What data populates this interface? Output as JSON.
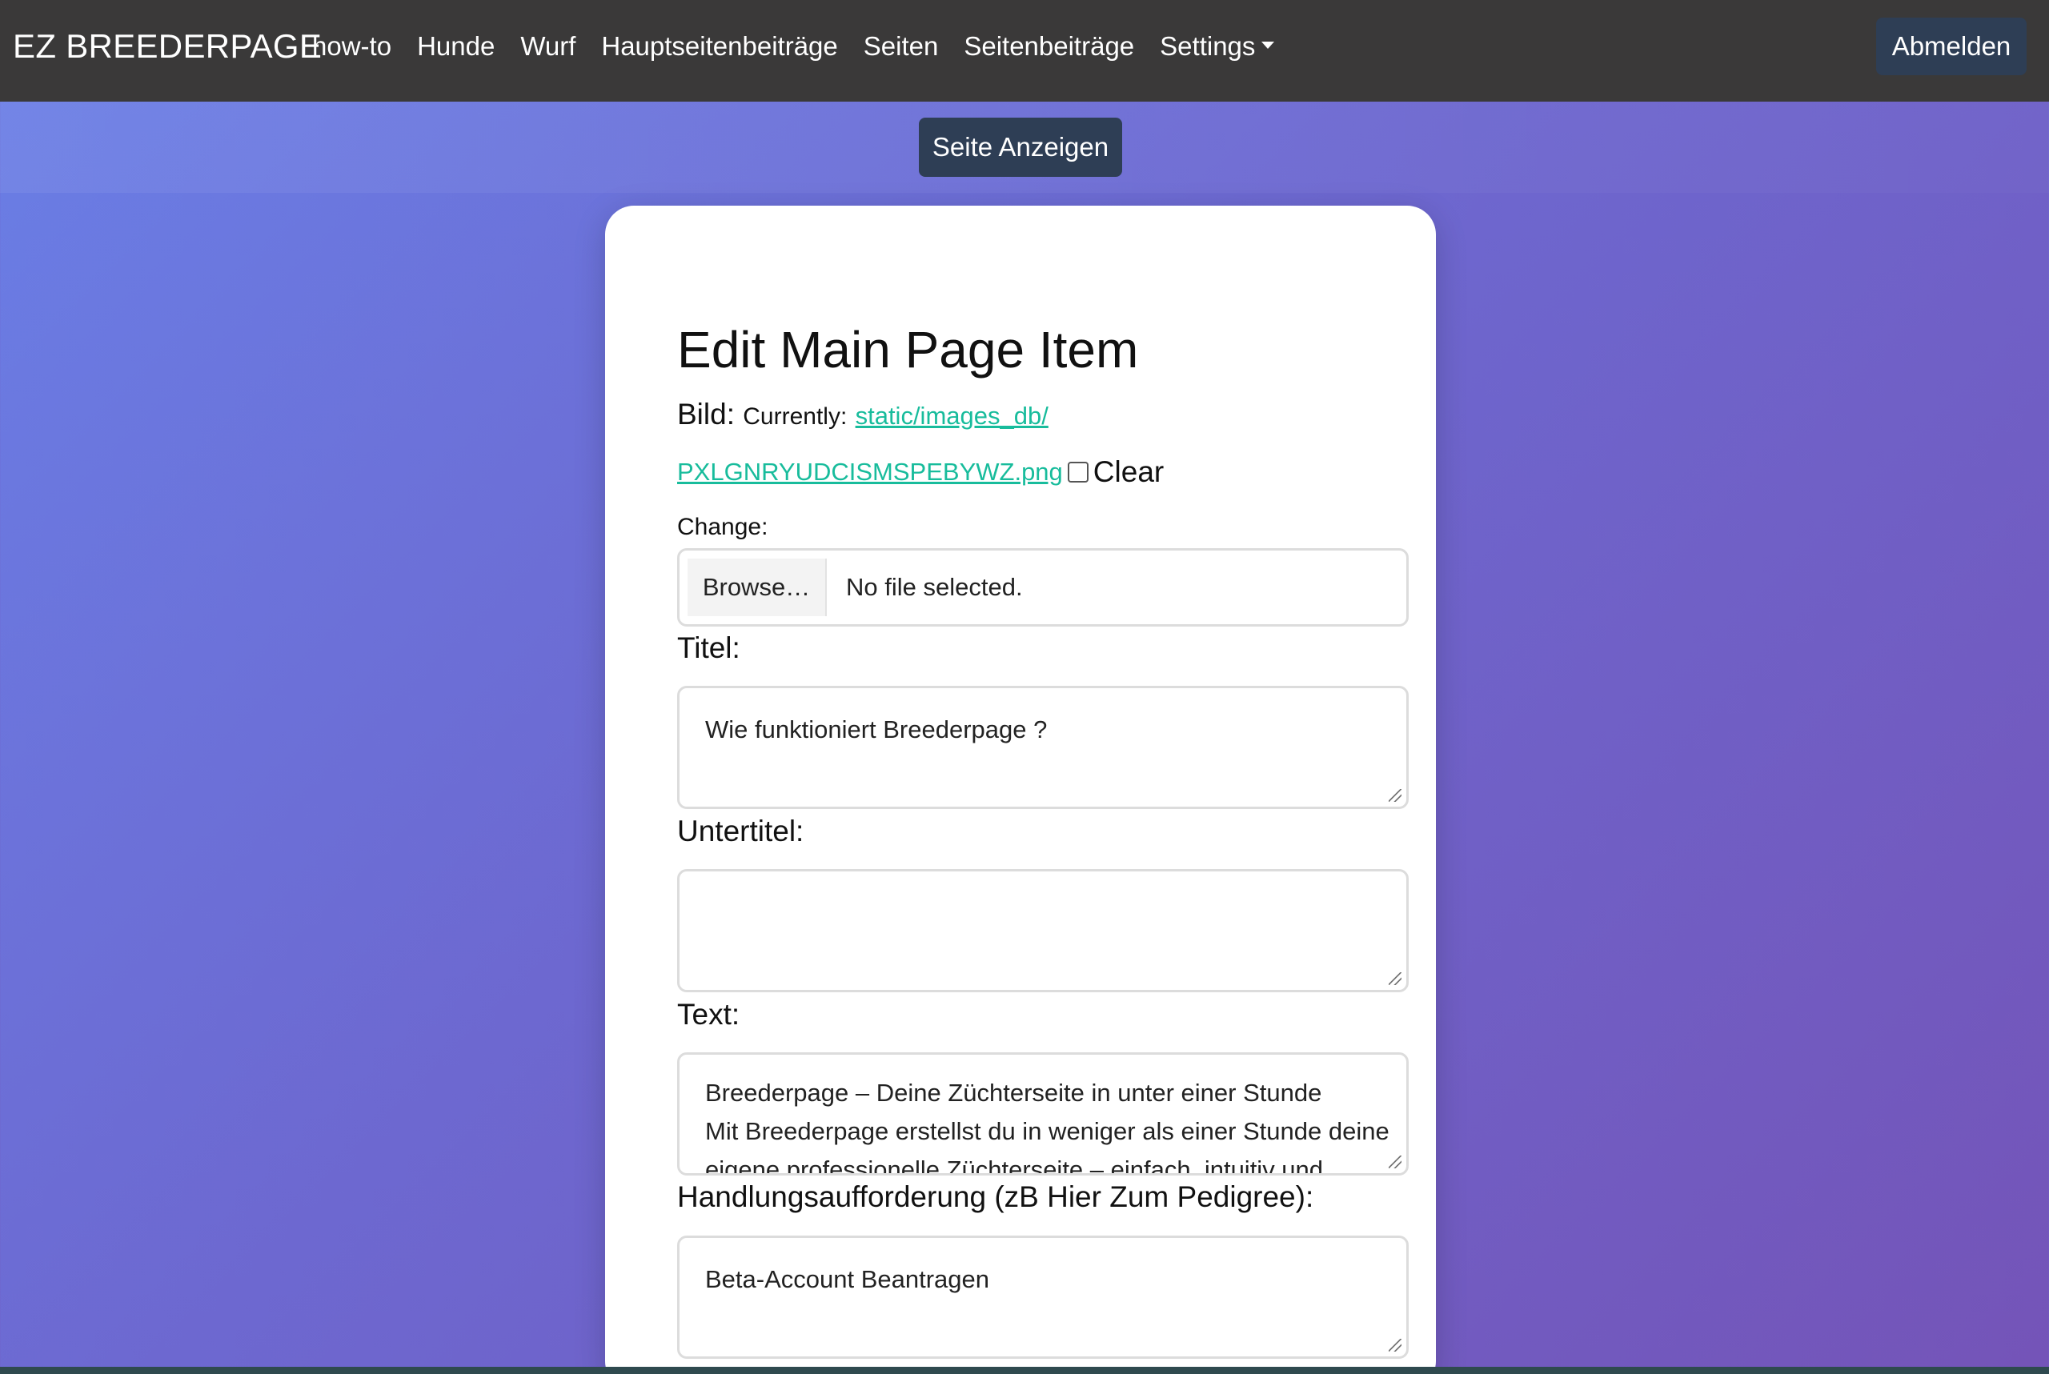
{
  "navbar": {
    "brand": "EZ BREEDERPAGE",
    "items": [
      {
        "label": "how-to"
      },
      {
        "label": "Hunde"
      },
      {
        "label": "Wurf"
      },
      {
        "label": "Hauptseitenbeiträge"
      },
      {
        "label": "Seiten"
      },
      {
        "label": "Seitenbeiträge"
      },
      {
        "label": "Settings"
      }
    ],
    "logout_label": "Abmelden"
  },
  "show_page_label": "Seite Anzeigen",
  "form": {
    "title": "Edit Main Page Item",
    "image": {
      "label": "Bild:",
      "currently_label": "Currently:",
      "link_part1": "static/images_db/",
      "link_part2": "PXLGNRYUDCISMSPEBYWZ.png",
      "clear_label": "Clear",
      "change_label": "Change:",
      "browse_label": "Browse…",
      "no_file_text": "No file selected."
    },
    "titel": {
      "label": "Titel:",
      "value": "Wie funktioniert Breederpage ?"
    },
    "untertitel": {
      "label": "Untertitel:",
      "value": ""
    },
    "text": {
      "label": "Text:",
      "lines": [
        "Breederpage – Deine Züchterseite in unter einer Stunde",
        "Mit Breederpage erstellst du in weniger als einer Stunde deine",
        "eigene professionelle Züchterseite – einfach, intuitiv und"
      ]
    },
    "cta": {
      "label": "Handlungsaufforderung (zB Hier Zum Pedigree):",
      "value": "Beta-Account Beantragen"
    }
  },
  "colors": {
    "navbar_bg": "#3a3939",
    "button_bg": "#2e3e55",
    "link": "#18bc9c",
    "gradient_start": "#6a7fe6",
    "gradient_end": "#7454b8"
  }
}
